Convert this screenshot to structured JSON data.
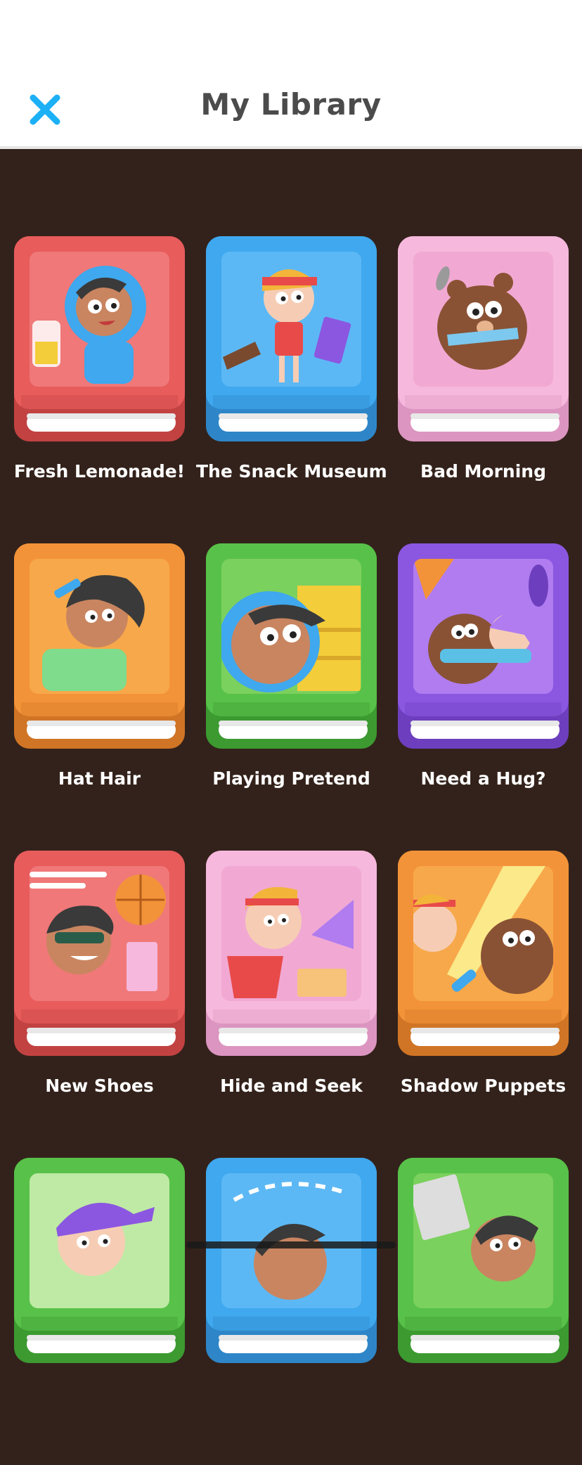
{
  "header": {
    "title": "My Library",
    "close_icon": "close-icon"
  },
  "colors": {
    "background": "#33221b",
    "close": "#1cb0f6",
    "title": "#4b4b4b"
  },
  "books": [
    {
      "title": "Fresh Lemonade!",
      "cover": "red",
      "main": "#e85c5c",
      "dark": "#c24242",
      "inner": "#f07878",
      "scene": "character-lemonade"
    },
    {
      "title": "The Snack Museum",
      "cover": "blue",
      "main": "#3fa8ee",
      "dark": "#2e86c8",
      "inner": "#5cb8f5",
      "scene": "character-museum"
    },
    {
      "title": "Bad Morning",
      "cover": "pink",
      "main": "#f6b8dc",
      "dark": "#dc95c0",
      "inner": "#f1a9d3",
      "scene": "bear-morning"
    },
    {
      "title": "Hat Hair",
      "cover": "orange",
      "main": "#f39339",
      "dark": "#d07525",
      "inner": "#f7a84a",
      "scene": "character-hair"
    },
    {
      "title": "Playing Pretend",
      "cover": "green",
      "main": "#58c149",
      "dark": "#3c9a31",
      "inner": "#7bd15d",
      "scene": "character-pretend"
    },
    {
      "title": "Need a Hug?",
      "cover": "purple",
      "main": "#8b57e0",
      "dark": "#6d3fbe",
      "inner": "#b07cf0",
      "scene": "characters-hug"
    },
    {
      "title": "New Shoes",
      "cover": "red",
      "main": "#e85c5c",
      "dark": "#c24242",
      "inner": "#f07878",
      "scene": "character-basketball"
    },
    {
      "title": "Hide and Seek",
      "cover": "pink",
      "main": "#f6b8dc",
      "dark": "#dc95c0",
      "inner": "#f1a9d3",
      "scene": "character-hide"
    },
    {
      "title": "Shadow Puppets",
      "cover": "orange",
      "main": "#f39339",
      "dark": "#d07525",
      "inner": "#f7a84a",
      "scene": "characters-flashlight"
    },
    {
      "title": "",
      "cover": "green",
      "main": "#58c149",
      "dark": "#3c9a31",
      "inner": "#bfeaa5",
      "scene": "character-cap"
    },
    {
      "title": "",
      "cover": "blue",
      "main": "#3fa8ee",
      "dark": "#2e86c8",
      "inner": "#5cb8f5",
      "scene": "character-map"
    },
    {
      "title": "",
      "cover": "green",
      "main": "#58c149",
      "dark": "#3c9a31",
      "inner": "#7bd15d",
      "scene": "character-newspaper"
    }
  ]
}
